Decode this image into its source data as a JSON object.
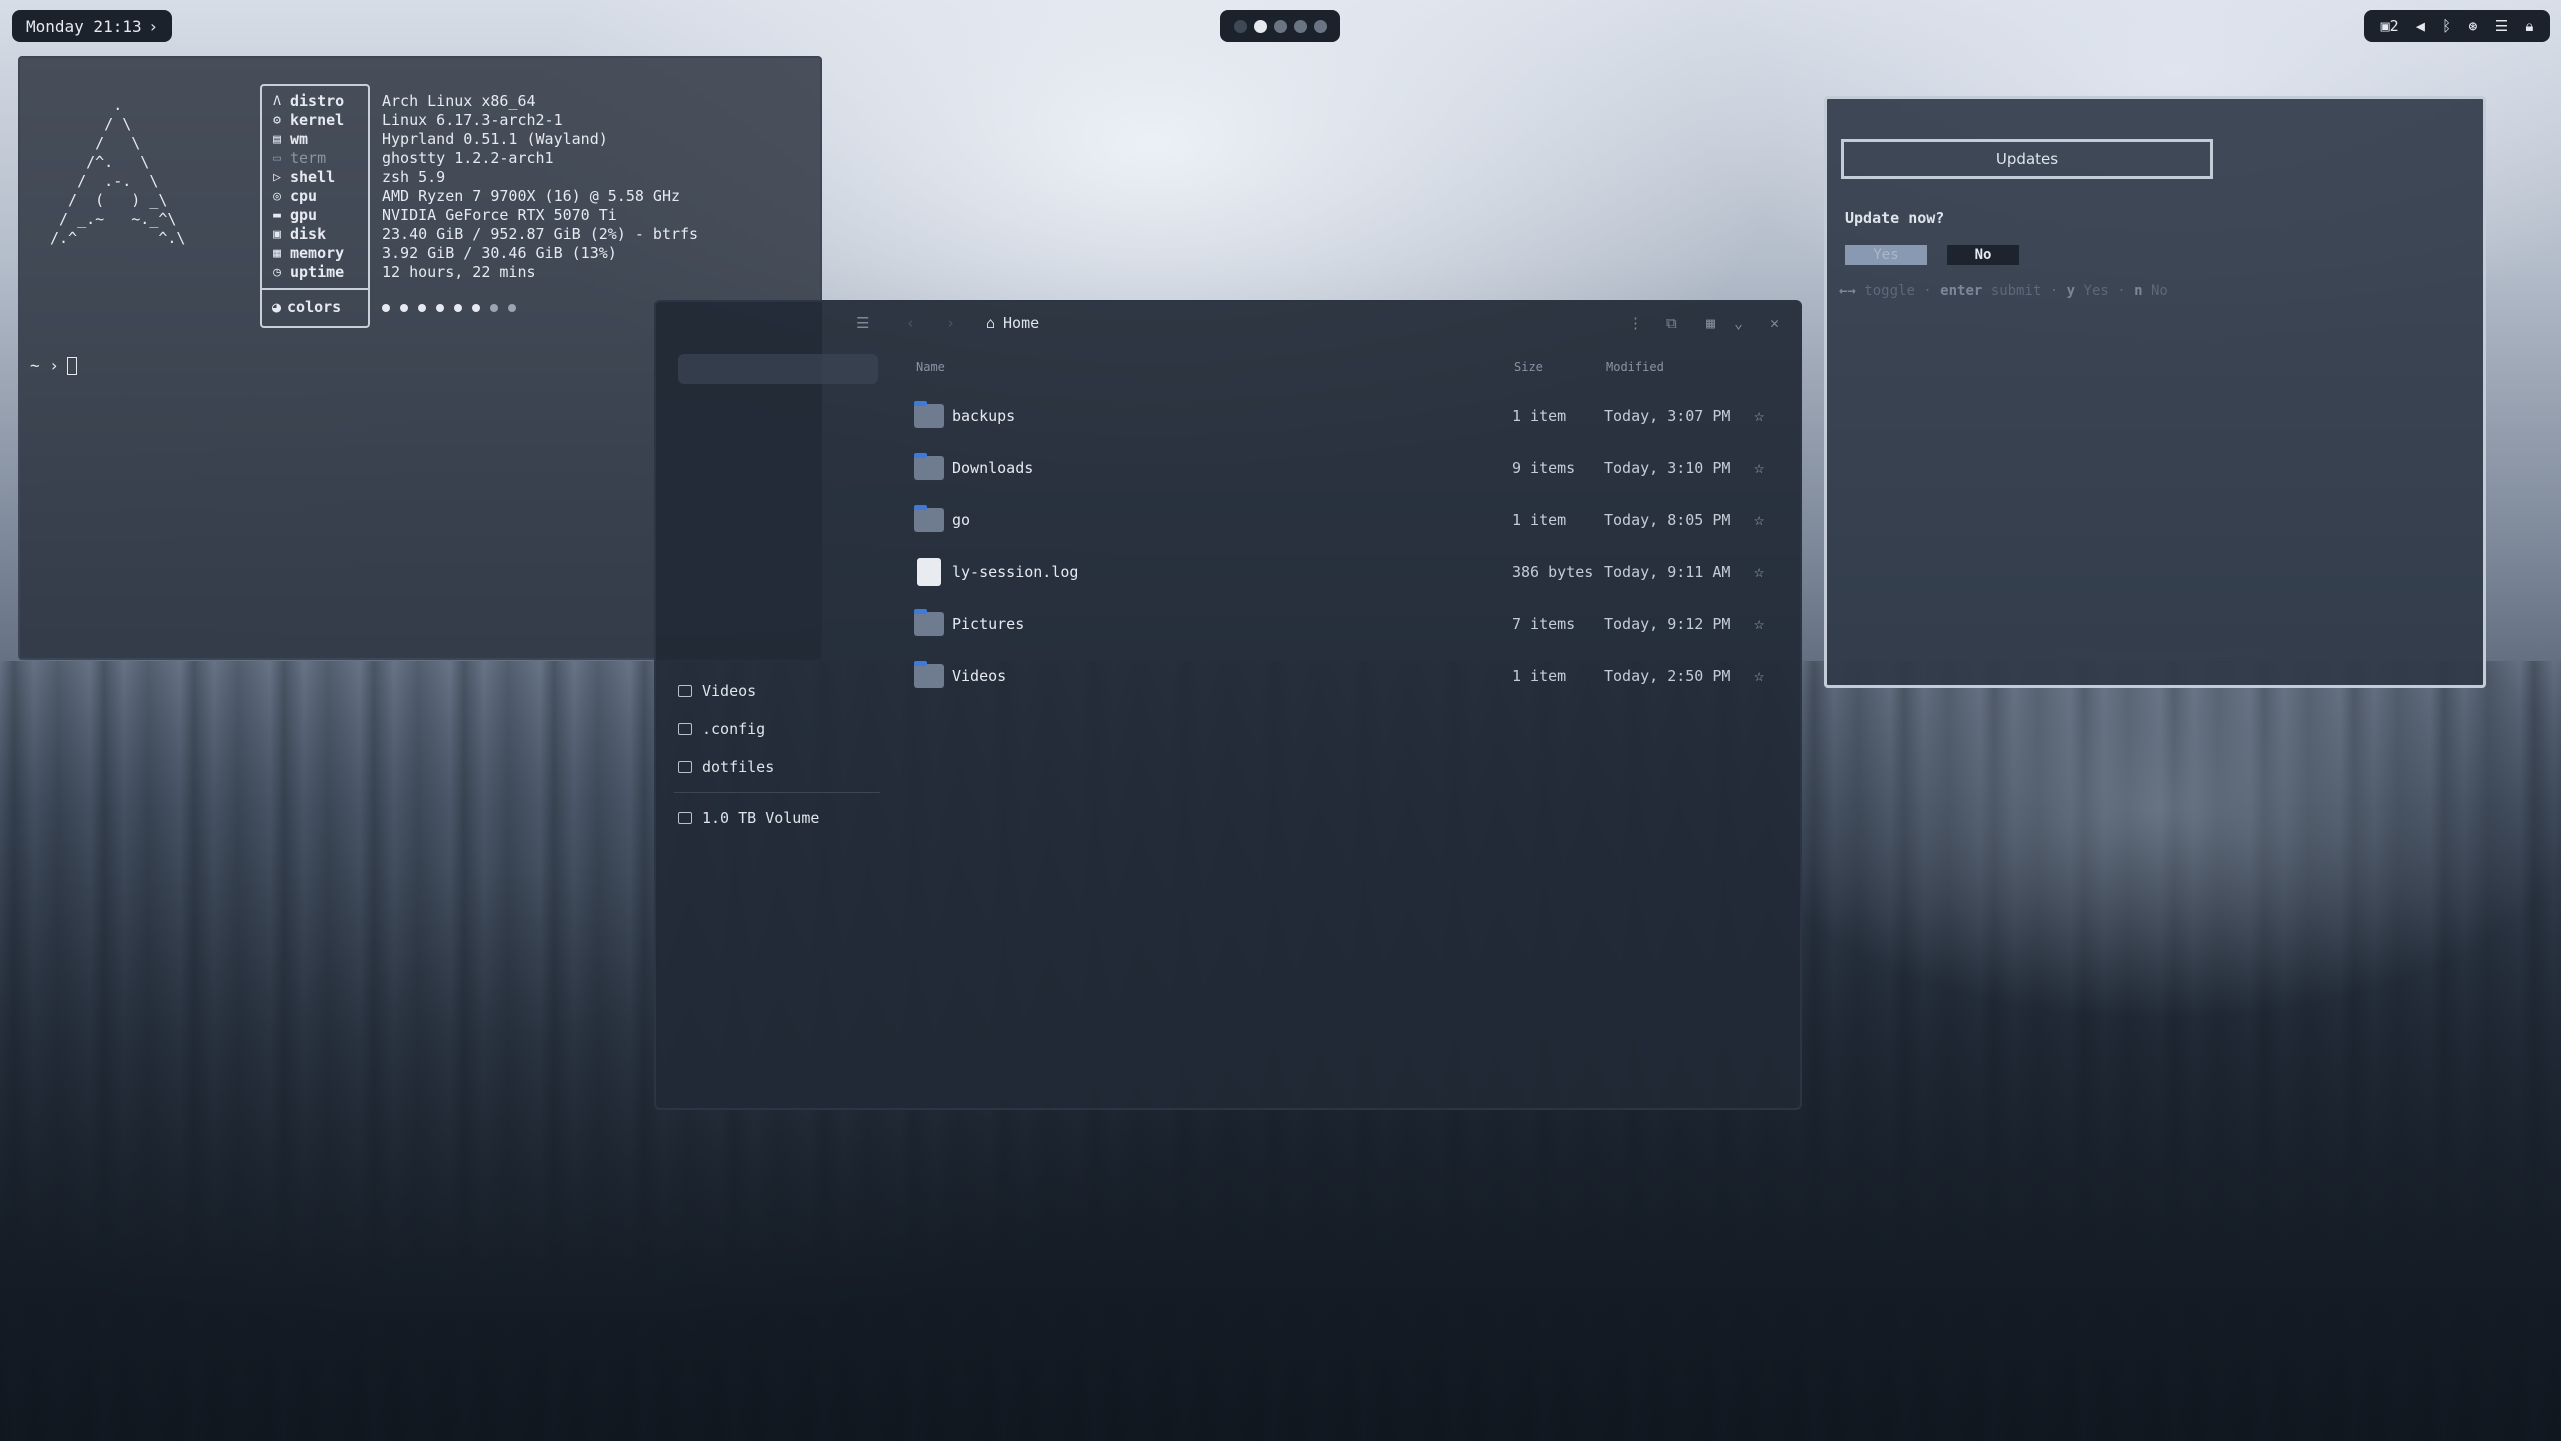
{
  "topbar": {
    "clock": "Monday 21:13",
    "clock_chevron": "›",
    "tray": {
      "workspace_count": "2"
    }
  },
  "terminal": {
    "ascii_logo": "       .\n      / \\\n     /   \\\n    /^.   \\\n   /  .-.  \\\n  /  (   ) _\\\n / _.~   ~._^\\\n/.^         ^.\\",
    "fields": [
      {
        "key": "distro",
        "value": "Arch Linux x86_64",
        "icon": "arch-icon"
      },
      {
        "key": "kernel",
        "value": "Linux 6.17.3-arch2-1",
        "icon": "gear-icon"
      },
      {
        "key": "wm",
        "value": "Hyprland 0.51.1 (Wayland)",
        "icon": "keyboard-icon"
      },
      {
        "key": "term",
        "value": "ghostty 1.2.2-arch1",
        "icon": "terminal-icon"
      },
      {
        "key": "shell",
        "value": "zsh 5.9",
        "icon": "shell-icon"
      },
      {
        "key": "cpu",
        "value": "AMD Ryzen 7 9700X (16) @ 5.58 GHz",
        "icon": "cpu-icon"
      },
      {
        "key": "gpu",
        "value": "NVIDIA GeForce RTX 5070 Ti",
        "icon": "gpu-icon"
      },
      {
        "key": "disk",
        "value": "23.40 GiB / 952.87 GiB (2%) - btrfs",
        "icon": "disk-icon"
      },
      {
        "key": "memory",
        "value": "3.92 GiB / 30.46 GiB (13%)",
        "icon": "memory-icon"
      },
      {
        "key": "uptime",
        "value": "12 hours, 22 mins",
        "icon": "clock-icon"
      }
    ],
    "colors_key": "colors",
    "prompt": "~ ›"
  },
  "filemanager": {
    "location": "Home",
    "columns": {
      "name": "Name",
      "size": "Size",
      "modified": "Modified"
    },
    "rows": [
      {
        "name": "backups",
        "size": "1 item",
        "modified": "Today, 3:07 PM"
      },
      {
        "name": "Downloads",
        "size": "9 items",
        "modified": "Today, 3:10 PM"
      },
      {
        "name": "go",
        "size": "1 item",
        "modified": "Today, 8:05 PM"
      },
      {
        "name": "ly-session.log",
        "size": "386 bytes",
        "modified": "Today, 9:11 AM"
      },
      {
        "name": "Pictures",
        "size": "7 items",
        "modified": "Today, 9:12 PM"
      },
      {
        "name": "Videos",
        "size": "1 item",
        "modified": "Today, 2:50 PM"
      }
    ],
    "sidebar": {
      "videos": "Videos",
      "config": ".config",
      "dotfiles": "dotfiles",
      "volume": "1.0 TB Volume"
    }
  },
  "updates": {
    "title": "Updates",
    "question": "Update now?",
    "yes": "Yes",
    "no": "No",
    "help": {
      "toggle_key": "←→",
      "toggle": "toggle",
      "submit_key": "enter",
      "submit": "submit",
      "yes_key": "y",
      "yes": "Yes",
      "no_key": "n",
      "no": "No"
    }
  },
  "colors": {
    "bar_bg": "#1b222c",
    "accent_folder": "#3d7bd8",
    "yes_button": "#8a99b2"
  }
}
